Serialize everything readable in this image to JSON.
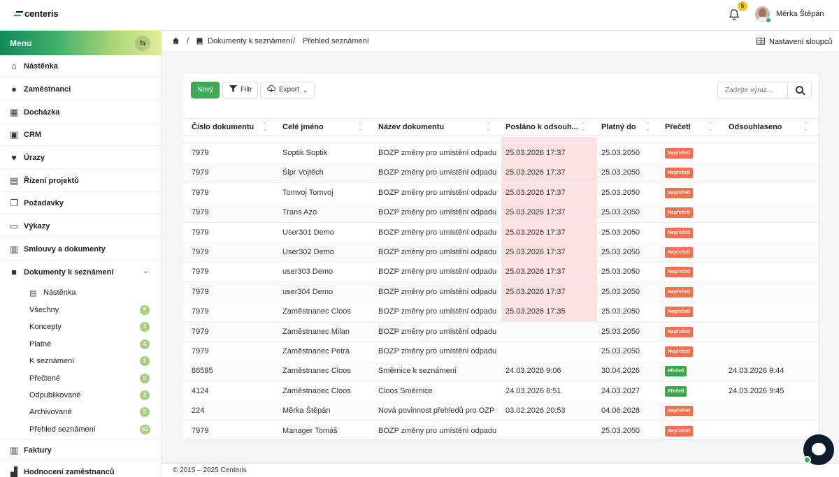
{
  "app": {
    "logo": "centeris"
  },
  "topbar": {
    "notifications_count": "5",
    "user_name": "Měrka Štěpán",
    "bell_icon": "bell-icon"
  },
  "sidebar": {
    "title": "Menu",
    "items": [
      {
        "label": "Nástěnka",
        "icon": "home-icon"
      },
      {
        "label": "Zaměstnanci",
        "icon": "user-icon"
      },
      {
        "label": "Docházka",
        "icon": "calendar-icon"
      },
      {
        "label": "CRM",
        "icon": "grid-icon"
      },
      {
        "label": "Úrazy",
        "icon": "heart-icon"
      },
      {
        "label": "Řízení projektů",
        "icon": "chat-icon"
      },
      {
        "label": "Požadavky",
        "icon": "copy-icon"
      },
      {
        "label": "Výkazy",
        "icon": "clipboard-icon"
      },
      {
        "label": "Smlouvy a dokumenty",
        "icon": "books-icon"
      },
      {
        "label": "Dokumenty k seznámení",
        "icon": "book-icon"
      }
    ],
    "submenu": {
      "dashboard": "Nástěnka",
      "items": [
        {
          "label": "Všechny",
          "count": "9"
        },
        {
          "label": "Koncepty",
          "count": "3"
        },
        {
          "label": "Platné",
          "count": "4"
        },
        {
          "label": "K seznámení",
          "count": "2"
        },
        {
          "label": "Přečtené",
          "count": "0"
        },
        {
          "label": "Odpublikované",
          "count": "2"
        },
        {
          "label": "Archivované",
          "count": "0"
        },
        {
          "label": "Přehled seznámení",
          "count": "53"
        }
      ]
    },
    "bottom_items": [
      {
        "label": "Faktury",
        "icon": "books-icon"
      },
      {
        "label": "Hodnocení zaměstnanců",
        "icon": "chart-icon"
      }
    ]
  },
  "breadcrumb": {
    "home_icon": "home-icon",
    "items": [
      "Dokumenty k seznámení",
      "Přehled seznámení"
    ],
    "separator": "/"
  },
  "column_settings": "Nastavení sloupců",
  "toolbar": {
    "new": "Nový",
    "filter": "Filtr",
    "export": "Export",
    "search_placeholder": "Zadejte výraz..."
  },
  "table": {
    "columns": [
      "Číslo dokumentu",
      "Celé jméno",
      "Název dokumentu",
      "Posláno k odsouh...",
      "Platný do",
      "Přečetl",
      "Odsouhlaseno"
    ],
    "rows": [
      {
        "num": "7979",
        "name": "Soptik Soptik",
        "doc": "BOZP změny pro umístění odpadu",
        "sent": "25.03.2026 17:37",
        "valid": "25.03.2050",
        "read": "Nepřečetl",
        "read_status": "red",
        "approved": "",
        "highlight": true
      },
      {
        "num": "7979",
        "name": "Šipr Vojtěch",
        "doc": "BOZP změny pro umístění odpadu",
        "sent": "25.03.2026 17:37",
        "valid": "25.03.2050",
        "read": "Nepřečetl",
        "read_status": "red",
        "approved": "",
        "highlight": true
      },
      {
        "num": "7979",
        "name": "Tomvoj Tomvoj",
        "doc": "BOZP změny pro umístění odpadu",
        "sent": "25.03.2026 17:37",
        "valid": "25.03.2050",
        "read": "Nepřečetl",
        "read_status": "red",
        "approved": "",
        "highlight": true
      },
      {
        "num": "7979",
        "name": "Trans Azo",
        "doc": "BOZP změny pro umístění odpadu",
        "sent": "25.03.2026 17:37",
        "valid": "25.03.2050",
        "read": "Nepřečetl",
        "read_status": "red",
        "approved": "",
        "highlight": true
      },
      {
        "num": "7979",
        "name": "User301 Demo",
        "doc": "BOZP změny pro umístění odpadu",
        "sent": "25.03.2026 17:37",
        "valid": "25.03.2050",
        "read": "Nepřečetl",
        "read_status": "red",
        "approved": "",
        "highlight": true
      },
      {
        "num": "7979",
        "name": "User302 Demo",
        "doc": "BOZP změny pro umístění odpadu",
        "sent": "25.03.2026 17:37",
        "valid": "25.03.2050",
        "read": "Nepřečetl",
        "read_status": "red",
        "approved": "",
        "highlight": true
      },
      {
        "num": "7979",
        "name": "user303 Demo",
        "doc": "BOZP změny pro umístění odpadu",
        "sent": "25.03.2026 17:37",
        "valid": "25.03.2050",
        "read": "Nepřečetl",
        "read_status": "red",
        "approved": "",
        "highlight": true
      },
      {
        "num": "7979",
        "name": "user304 Demo",
        "doc": "BOZP změny pro umístění odpadu",
        "sent": "25.03.2026 17:37",
        "valid": "25.03.2050",
        "read": "Nepřečetl",
        "read_status": "red",
        "approved": "",
        "highlight": true
      },
      {
        "num": "7979",
        "name": "Zaměstnanec Cloos",
        "doc": "BOZP změny pro umístění odpadu",
        "sent": "25.03.2026 17:35",
        "valid": "25.03.2050",
        "read": "Nepřečetl",
        "read_status": "red",
        "approved": "",
        "highlight": true
      },
      {
        "num": "7979",
        "name": "Zaměstnanec Milan",
        "doc": "BOZP změny pro umístění odpadu",
        "sent": "",
        "valid": "25.03.2050",
        "read": "Nepřečetl",
        "read_status": "red",
        "approved": "",
        "highlight": false
      },
      {
        "num": "7979",
        "name": "Zaměstnanec Petra",
        "doc": "BOZP změny pro umístění odpadu",
        "sent": "",
        "valid": "25.03.2050",
        "read": "Nepřečetl",
        "read_status": "red",
        "approved": "",
        "highlight": false
      },
      {
        "num": "86585",
        "name": "Zaměstnanec Cloos",
        "doc": "Směrnice k seznámení",
        "sent": "24.03.2026 9:06",
        "valid": "30.04.2026",
        "read": "Přečetl",
        "read_status": "green",
        "approved": "24.03.2026 9:44",
        "highlight": false
      },
      {
        "num": "4124",
        "name": "Zaměstnanec Cloos",
        "doc": "Cloos Směrnice",
        "sent": "24.03.2026 8:51",
        "valid": "24.03.2027",
        "read": "Přečetl",
        "read_status": "green",
        "approved": "24.03.2026 9:45",
        "highlight": false
      },
      {
        "num": "224",
        "name": "Měrka Štěpán",
        "doc": "Nová povinnost přehledů pro OZP",
        "sent": "03.02.2026 20:53",
        "valid": "04.06.2028",
        "read": "Nepřečetl",
        "read_status": "red",
        "approved": "",
        "highlight": false
      },
      {
        "num": "7979",
        "name": "Manager Tomáš",
        "doc": "BOZP změny pro umístění odpadu",
        "sent": "",
        "valid": "25.03.2050",
        "read": "Nepřečetl",
        "read_status": "red",
        "approved": "",
        "highlight": false
      }
    ]
  },
  "footer": {
    "copyright": "© 2015 – 2025 Centeris"
  },
  "colors": {
    "accent_green": "#3eaa54",
    "badge_red": "#f0704f",
    "badge_green": "#39a64b",
    "highlight_pink": "#fbe1e1"
  }
}
